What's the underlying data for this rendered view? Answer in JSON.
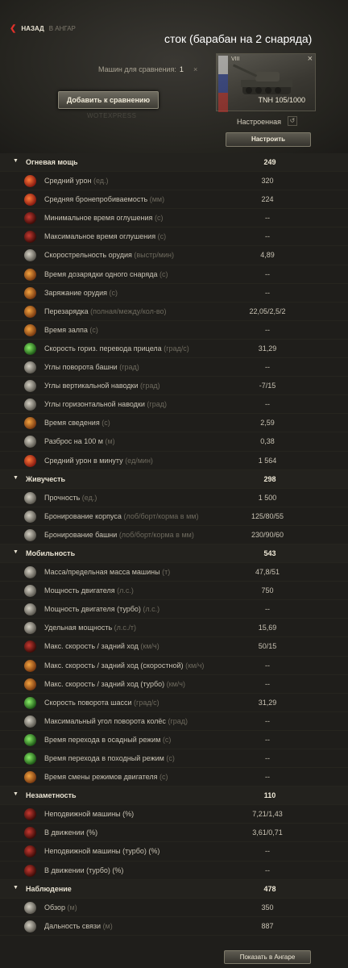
{
  "nav": {
    "arrow": "❮",
    "back_label": "НАЗАД",
    "hangar_label": "В АНГАР"
  },
  "caption": "сток (барабан на 2 снаряда)",
  "compare": {
    "label": "Машин для сравнения:",
    "count": "1",
    "close": "×",
    "add_button": "Добавить к сравнению"
  },
  "watermark": "WOTEXPRESS",
  "tank": {
    "tier": "VIII",
    "name": "TNH 105/1000",
    "close": "×",
    "status": "Настроенная",
    "reset_icon": "↺",
    "setup_button": "Настроить"
  },
  "colors": {
    "accent_red": "#e0312a",
    "background": "#1f1e1b",
    "text": "#c9c3b4"
  },
  "sections": [
    {
      "title": "Огневая мощь",
      "value": "249",
      "rows": [
        {
          "label": "Средний урон",
          "unit": "(ед.)",
          "value": "320",
          "icon": "damage-icon",
          "color": "red"
        },
        {
          "label": "Средняя бронепробиваемость",
          "unit": "(мм)",
          "value": "224",
          "icon": "penetration-icon",
          "color": "red"
        },
        {
          "label": "Минимальное время оглушения",
          "unit": "(с)",
          "value": "--",
          "icon": "stun-min-icon",
          "color": "darkred"
        },
        {
          "label": "Максимальное время оглушения",
          "unit": "(с)",
          "value": "--",
          "icon": "stun-max-icon",
          "color": "darkred"
        },
        {
          "label": "Скорострельность орудия",
          "unit": "(выстр/мин)",
          "value": "4,89",
          "icon": "rate-of-fire-icon",
          "color": "gray"
        },
        {
          "label": "Время дозарядки одного снаряда",
          "unit": "(с)",
          "value": "--",
          "icon": "shell-reload-icon",
          "color": "orange"
        },
        {
          "label": "Заряжание орудия",
          "unit": "(с)",
          "value": "--",
          "icon": "gun-loading-icon",
          "color": "orange"
        },
        {
          "label": "Перезарядка",
          "unit": "(полная/между/кол-во)",
          "value": "22,05/2,5/2",
          "icon": "magazine-reload-icon",
          "color": "orange"
        },
        {
          "label": "Время залпа",
          "unit": "(с)",
          "value": "--",
          "icon": "salvo-time-icon",
          "color": "orange"
        },
        {
          "label": "Скорость гориз. перевода прицела",
          "unit": "(град/с)",
          "value": "31,29",
          "icon": "traverse-speed-icon",
          "color": "green"
        },
        {
          "label": "Углы поворота башни",
          "unit": "(град)",
          "value": "--",
          "icon": "turret-angle-icon",
          "color": "gray"
        },
        {
          "label": "Углы вертикальной наводки",
          "unit": "(град)",
          "value": "-7/15",
          "icon": "elevation-icon",
          "color": "gray"
        },
        {
          "label": "Углы горизонтальной наводки",
          "unit": "(град)",
          "value": "--",
          "icon": "horizontal-aim-icon",
          "color": "gray"
        },
        {
          "label": "Время сведения",
          "unit": "(с)",
          "value": "2,59",
          "icon": "aim-time-icon",
          "color": "orange"
        },
        {
          "label": "Разброс на 100 м",
          "unit": "(м)",
          "value": "0,38",
          "icon": "dispersion-icon",
          "color": "gray"
        },
        {
          "label": "Средний урон в минуту",
          "unit": "(ед/мин)",
          "value": "1 564",
          "icon": "dpm-icon",
          "color": "red"
        }
      ]
    },
    {
      "title": "Живучесть",
      "value": "298",
      "rows": [
        {
          "label": "Прочность",
          "unit": "(ед.)",
          "value": "1 500",
          "icon": "hit-points-icon",
          "color": "gray"
        },
        {
          "label": "Бронирование корпуса",
          "unit": "(лоб/борт/корма в мм)",
          "value": "125/80/55",
          "icon": "hull-armor-icon",
          "color": "gray"
        },
        {
          "label": "Бронирование башни",
          "unit": "(лоб/борт/корма в мм)",
          "value": "230/90/60",
          "icon": "turret-armor-icon",
          "color": "gray"
        }
      ]
    },
    {
      "title": "Мобильность",
      "value": "543",
      "rows": [
        {
          "label": "Масса/предельная масса машины",
          "unit": "(т)",
          "value": "47,8/51",
          "icon": "weight-icon",
          "color": "gray"
        },
        {
          "label": "Мощность двигателя",
          "unit": "(л.с.)",
          "value": "750",
          "icon": "engine-power-icon",
          "color": "gray"
        },
        {
          "label": "Мощность двигателя (турбо)",
          "unit": "(л.с.)",
          "value": "--",
          "icon": "engine-turbo-icon",
          "color": "gray"
        },
        {
          "label": "Удельная мощность",
          "unit": "(л.с./т)",
          "value": "15,69",
          "icon": "power-ratio-icon",
          "color": "gray"
        },
        {
          "label": "Макс. скорость / задний ход",
          "unit": "(км/ч)",
          "value": "50/15",
          "icon": "speed-icon",
          "color": "darkred"
        },
        {
          "label": "Макс. скорость / задний ход (скоростной)",
          "unit": "(км/ч)",
          "value": "--",
          "icon": "speed-mode-icon",
          "color": "orange"
        },
        {
          "label": "Макс. скорость / задний ход (турбо)",
          "unit": "(км/ч)",
          "value": "--",
          "icon": "speed-turbo-icon",
          "color": "orange"
        },
        {
          "label": "Скорость поворота шасси",
          "unit": "(град/с)",
          "value": "31,29",
          "icon": "hull-traverse-icon",
          "color": "green"
        },
        {
          "label": "Максимальный угол поворота колёс",
          "unit": "(град)",
          "value": "--",
          "icon": "wheel-angle-icon",
          "color": "gray"
        },
        {
          "label": "Время перехода в осадный режим",
          "unit": "(с)",
          "value": "--",
          "icon": "siege-mode-icon",
          "color": "green"
        },
        {
          "label": "Время перехода в походный режим",
          "unit": "(с)",
          "value": "--",
          "icon": "travel-mode-icon",
          "color": "green"
        },
        {
          "label": "Время смены режимов двигателя",
          "unit": "(с)",
          "value": "--",
          "icon": "engine-mode-icon",
          "color": "orange"
        }
      ]
    },
    {
      "title": "Незаметность",
      "value": "110",
      "rows": [
        {
          "label": "Неподвижной машины (%)",
          "unit": "",
          "value": "7,21/1,43",
          "icon": "camo-stationary-icon",
          "color": "darkred"
        },
        {
          "label": "В движении (%)",
          "unit": "",
          "value": "3,61/0,71",
          "icon": "camo-moving-icon",
          "color": "darkred"
        },
        {
          "label": "Неподвижной машины (турбо) (%)",
          "unit": "",
          "value": "--",
          "icon": "camo-stationary-turbo-icon",
          "color": "darkred"
        },
        {
          "label": "В движении (турбо) (%)",
          "unit": "",
          "value": "--",
          "icon": "camo-moving-turbo-icon",
          "color": "darkred"
        }
      ]
    },
    {
      "title": "Наблюдение",
      "value": "478",
      "rows": [
        {
          "label": "Обзор",
          "unit": "(м)",
          "value": "350",
          "icon": "view-range-icon",
          "color": "gray"
        },
        {
          "label": "Дальность связи",
          "unit": "(м)",
          "value": "887",
          "icon": "radio-range-icon",
          "color": "gray"
        }
      ]
    }
  ],
  "footer": {
    "show_in_hangar": "Показать в Ангаре"
  }
}
